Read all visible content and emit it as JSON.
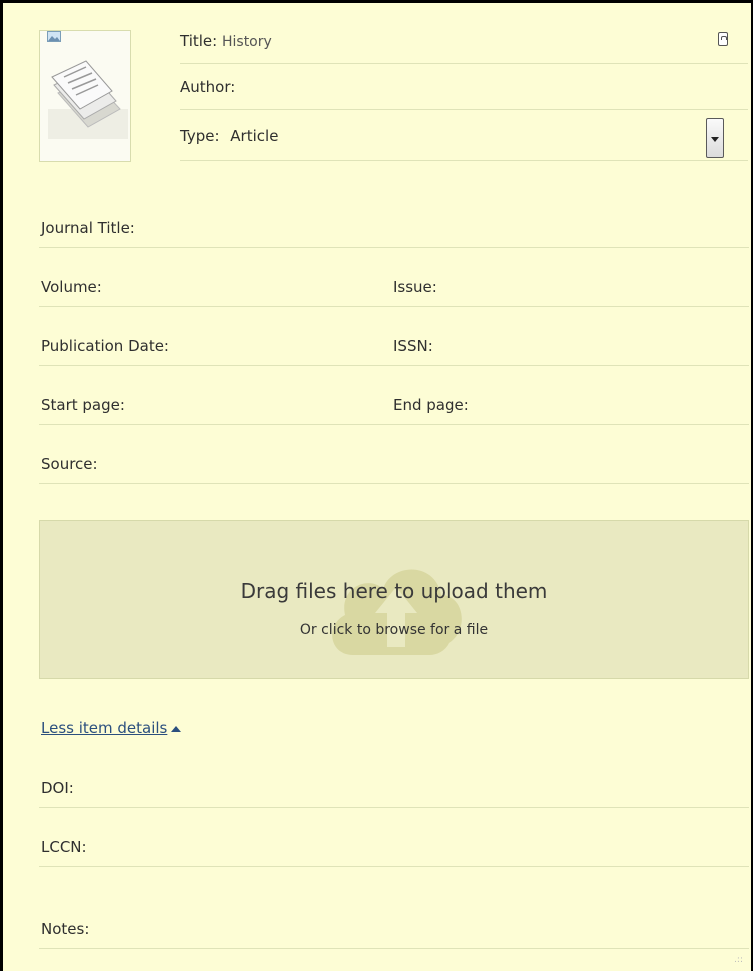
{
  "header": {
    "title_label": "Title:",
    "title_value": "History",
    "author_label": "Author:",
    "author_value": "",
    "type_label": "Type:",
    "type_value": "Article"
  },
  "fields": {
    "journal_title": "Journal Title:",
    "volume": "Volume:",
    "issue": "Issue:",
    "publication_date": "Publication Date:",
    "issn": "ISSN:",
    "start_page": "Start page:",
    "end_page": "End page:",
    "source": "Source:"
  },
  "upload": {
    "title": "Drag files here to upload them",
    "subtitle": "Or click to browse for a file"
  },
  "details": {
    "toggle_label": "Less item details",
    "doi": "DOI:",
    "lccn": "LCCN:",
    "notes": "Notes:"
  },
  "icons": {
    "thumbnail": "document-pages-icon",
    "image": "image-icon",
    "clipboard": "clipboard-icon",
    "dropdown": "chevron-down-icon",
    "upload": "cloud-upload-icon",
    "toggle": "triangle-up-icon"
  },
  "colors": {
    "background": "#fdfdd5",
    "border": "#000000",
    "dropzone": "#e9e9c1",
    "link": "#2b4f7e",
    "divider": "#dfe3b8"
  }
}
